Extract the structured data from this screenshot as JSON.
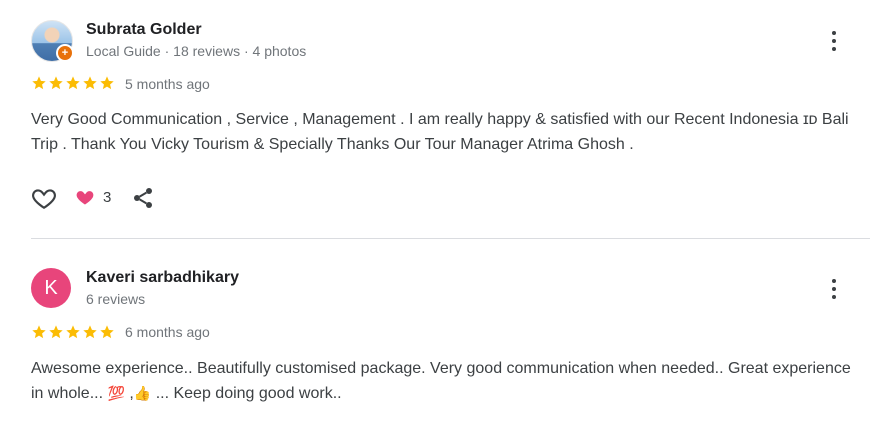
{
  "reviews": [
    {
      "author": "Subrata Golder",
      "meta": "Local Guide · 18 reviews · 4 photos",
      "rating": 5,
      "time": "5 months ago",
      "text": "Very Good Communication , Service , Management . I am really happy & satisfied with our Recent Indonesia ɪᴅ Bali Trip . Thank You Vicky Tourism & Specially Thanks Our Tour Manager Atrima Ghosh .",
      "reaction_count": "3",
      "avatar_icon": "profile-photo"
    },
    {
      "author": "Kaveri sarbadhikary",
      "avatar_letter": "K",
      "meta": "6 reviews",
      "rating": 5,
      "time": "6 months ago",
      "text_part1": "Awesome experience.. Beautifully customised package. Very good communication when needed.. Great experience in whole... ",
      "emoji1": "💯",
      "text_part2": " ,",
      "emoji2": "👍",
      "text_part3": " ... Keep doing good work.."
    }
  ],
  "colors": {
    "star": "#fbbc04",
    "avatar_k": "#e8457b",
    "guide_badge": "#e8710a",
    "reaction_heart": "#e8457b"
  }
}
